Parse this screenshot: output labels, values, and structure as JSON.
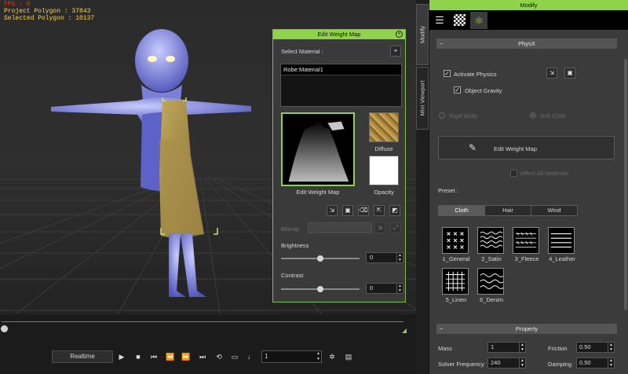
{
  "hud": {
    "fps": "FPS : 0",
    "project_polygon": "Project Polygon : 37843",
    "selected_polygon": "Selected Polygon : 10137"
  },
  "weight_map": {
    "title": "Edit Weight Map",
    "select_material_label": "Select Material :",
    "materials": [
      "Robe:Material1"
    ],
    "edit_weight_map_label": "Edit Weight Map",
    "diffuse_label": "Diffuse",
    "opacity_label": "Opacity",
    "bitmap_label": "Bitmap",
    "brightness_label": "Brightness",
    "brightness_value": "0",
    "brightness_level": 0.5,
    "contrast_label": "Contrast",
    "contrast_value": "0",
    "contrast_level": 0.5
  },
  "side_tabs": {
    "modify": "Modify",
    "mini_viewport": "Mini Viewport"
  },
  "timeline": {
    "realtime_label": "Realtime",
    "frame_value": "1",
    "position": 0.0
  },
  "modify_panel": {
    "title": "Modify",
    "tabs": [
      "sliders-icon",
      "checker-icon",
      "atom-icon"
    ],
    "physx_header": "PhysX",
    "activate_physics": "Activate Physics",
    "activate_physics_checked": true,
    "object_gravity": "Object Gravity",
    "object_gravity_checked": true,
    "rigid_body": "Rigid Body",
    "soft_cloth": "Soft Cloth",
    "edit_weight_map_button": "Edit Weight Map",
    "affect_all_materials": "Affect All Materials",
    "preset_label": "Preset :",
    "preset_tabs": [
      "Cloth",
      "Hair",
      "Wind"
    ],
    "presets": [
      "1_General",
      "2_Satin",
      "3_Fleece",
      "4_Leather",
      "5_Linen",
      "6_Denim"
    ],
    "property_header": "Property",
    "properties": {
      "mass_label": "Mass",
      "mass_value": "1",
      "friction_label": "Friction",
      "friction_value": "0.50",
      "solver_label": "Solver Frequency",
      "solver_value": "240",
      "damping_label": "Damping",
      "damping_value": "0.50"
    }
  },
  "colors": {
    "accent": "#8ed349",
    "hud_yellow": "#ffd24a",
    "hud_red": "#e0302a"
  }
}
